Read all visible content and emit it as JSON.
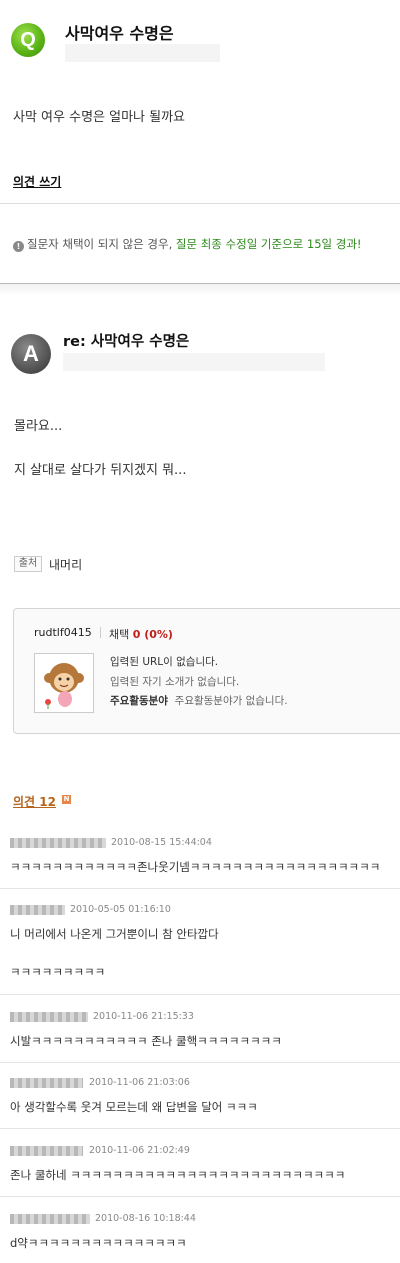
{
  "question": {
    "badge": "Q",
    "title": "사막여우 수명은",
    "body": "사막 여우 수명은 얼마나 될까요",
    "opinion_write": "의견 쓰기",
    "notice_prefix": "질문자 채택이 되지 않은 경우,",
    "notice_highlight": "질문 최종 수정일 기준으로 15일 경과!"
  },
  "answer": {
    "badge": "A",
    "title": "re: 사막여우 수명은",
    "lines": [
      "몰라요...",
      "지 살대로 살다가 뒤지겠지 뭐..."
    ],
    "source_label": "출처",
    "source_value": "내머리"
  },
  "profile": {
    "username": "rudtlf0415",
    "select_label": "채택",
    "select_count": "0 (0%)",
    "url_text": "입력된 URL이 없습니다.",
    "intro_text": "입력된 자기 소개가 없습니다.",
    "field_label": "주요활동분야",
    "field_value": "주요활동분야가 없습니다."
  },
  "opinions": {
    "header": "의견 12",
    "new_badge": "N",
    "comments": [
      {
        "date": "2010-08-15 15:44:04",
        "text": "ㅋㅋㅋㅋㅋㅋㅋㅋㅋㅋㅋㅋ존나웃기넴ㅋㅋㅋㅋㅋㅋㅋㅋㅋㅋㅋㅋㅋㅋㅋㅋㅋㅋ"
      },
      {
        "date": "2010-05-05 01:16:10",
        "text": "니 머리에서 나온게 그거뿐이니 참 안타깝다",
        "text2": "ㅋㅋㅋㅋㅋㅋㅋㅋㅋ"
      },
      {
        "date": "2010-11-06 21:15:33",
        "text": "시발ㅋㅋㅋㅋㅋㅋㅋㅋㅋㅋㅋ 존나 쿨핵ㅋㅋㅋㅋㅋㅋㅋㅋ"
      },
      {
        "date": "2010-11-06 21:03:06",
        "text": "아 생각할수록 웃겨 모르는데 왜 답변을 달어 ㅋㅋㅋ"
      },
      {
        "date": "2010-11-06 21:02:49",
        "text": "존나 쿨하네 ㅋㅋㅋㅋㅋㅋㅋㅋㅋㅋㅋㅋㅋㅋㅋㅋㅋㅋㅋㅋㅋㅋㅋㅋㅋㅋ"
      },
      {
        "date": "2010-08-16 10:18:44",
        "text": "d약ㅋㅋㅋㅋㅋㅋㅋㅋㅋㅋㅋㅋㅋㅋㅋ"
      }
    ]
  }
}
